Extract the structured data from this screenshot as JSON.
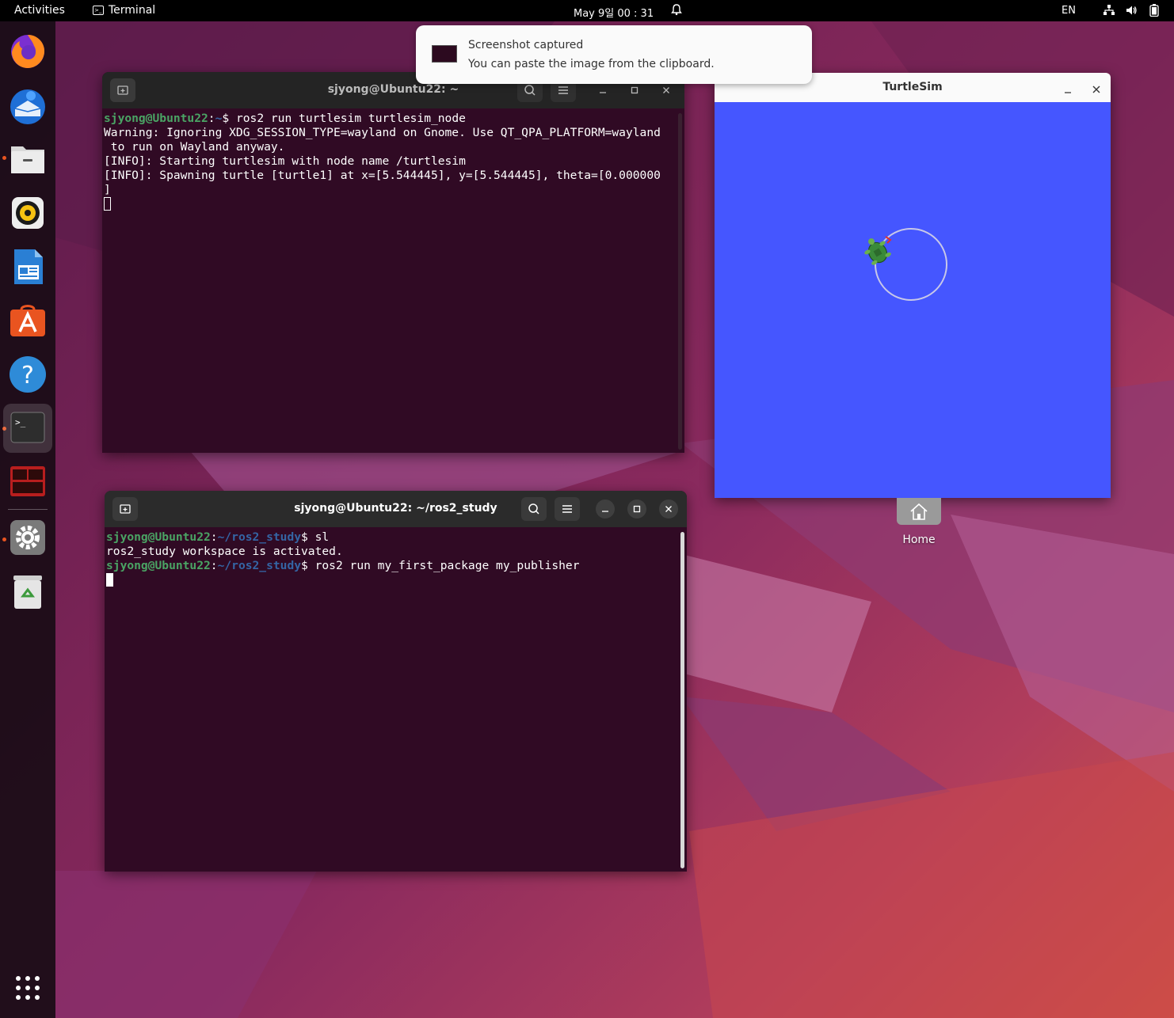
{
  "topbar": {
    "activities": "Activities",
    "app_name": "Terminal",
    "clock": "May 9일  00 : 31",
    "language": "EN"
  },
  "dock": {
    "items": [
      {
        "name": "firefox",
        "icon": "firefox-icon"
      },
      {
        "name": "thunderbird",
        "icon": "thunderbird-icon"
      },
      {
        "name": "files",
        "icon": "files-icon",
        "running": true
      },
      {
        "name": "rhythmbox",
        "icon": "rhythmbox-icon"
      },
      {
        "name": "libreoffice-writer",
        "icon": "writer-icon"
      },
      {
        "name": "ubuntu-software",
        "icon": "software-icon"
      },
      {
        "name": "help",
        "icon": "help-icon"
      },
      {
        "name": "terminal",
        "icon": "terminal-icon",
        "running": true,
        "active": true
      },
      {
        "name": "terminator",
        "icon": "terminator-icon"
      },
      {
        "name": "settings",
        "icon": "settings-icon",
        "running": true
      },
      {
        "name": "trash",
        "icon": "trash-icon"
      }
    ],
    "show_apps": "apps-grid-icon"
  },
  "notification": {
    "title": "Screenshot captured",
    "body": "You can paste the image from the clipboard."
  },
  "terminal1": {
    "title": "sjyong@Ubuntu22: ~",
    "prompt_user": "sjyong@Ubuntu22",
    "prompt_path": "~",
    "command": "ros2 run turtlesim turtlesim_node",
    "output": [
      "Warning: Ignoring XDG_SESSION_TYPE=wayland on Gnome. Use QT_QPA_PLATFORM=wayland",
      " to run on Wayland anyway.",
      "[INFO]: Starting turtlesim with node name /turtlesim",
      "[INFO]: Spawning turtle [turtle1] at x=[5.544445], y=[5.544445], theta=[0.000000",
      "]"
    ]
  },
  "terminal2": {
    "title": "sjyong@Ubuntu22: ~/ros2_study",
    "prompt_user": "sjyong@Ubuntu22",
    "prompt_path": "~/ros2_study",
    "command1": "sl",
    "output1": "ros2_study workspace is activated.",
    "command2": "ros2 run my_first_package my_publisher"
  },
  "turtlesim": {
    "title": "TurtleSim",
    "background": "#4556ff"
  },
  "desktop": {
    "home_label": "Home"
  },
  "colors": {
    "terminal_bg": "#300a24",
    "prompt_user": "#4aa464",
    "prompt_path": "#3465a4",
    "accent": "#e95420"
  }
}
